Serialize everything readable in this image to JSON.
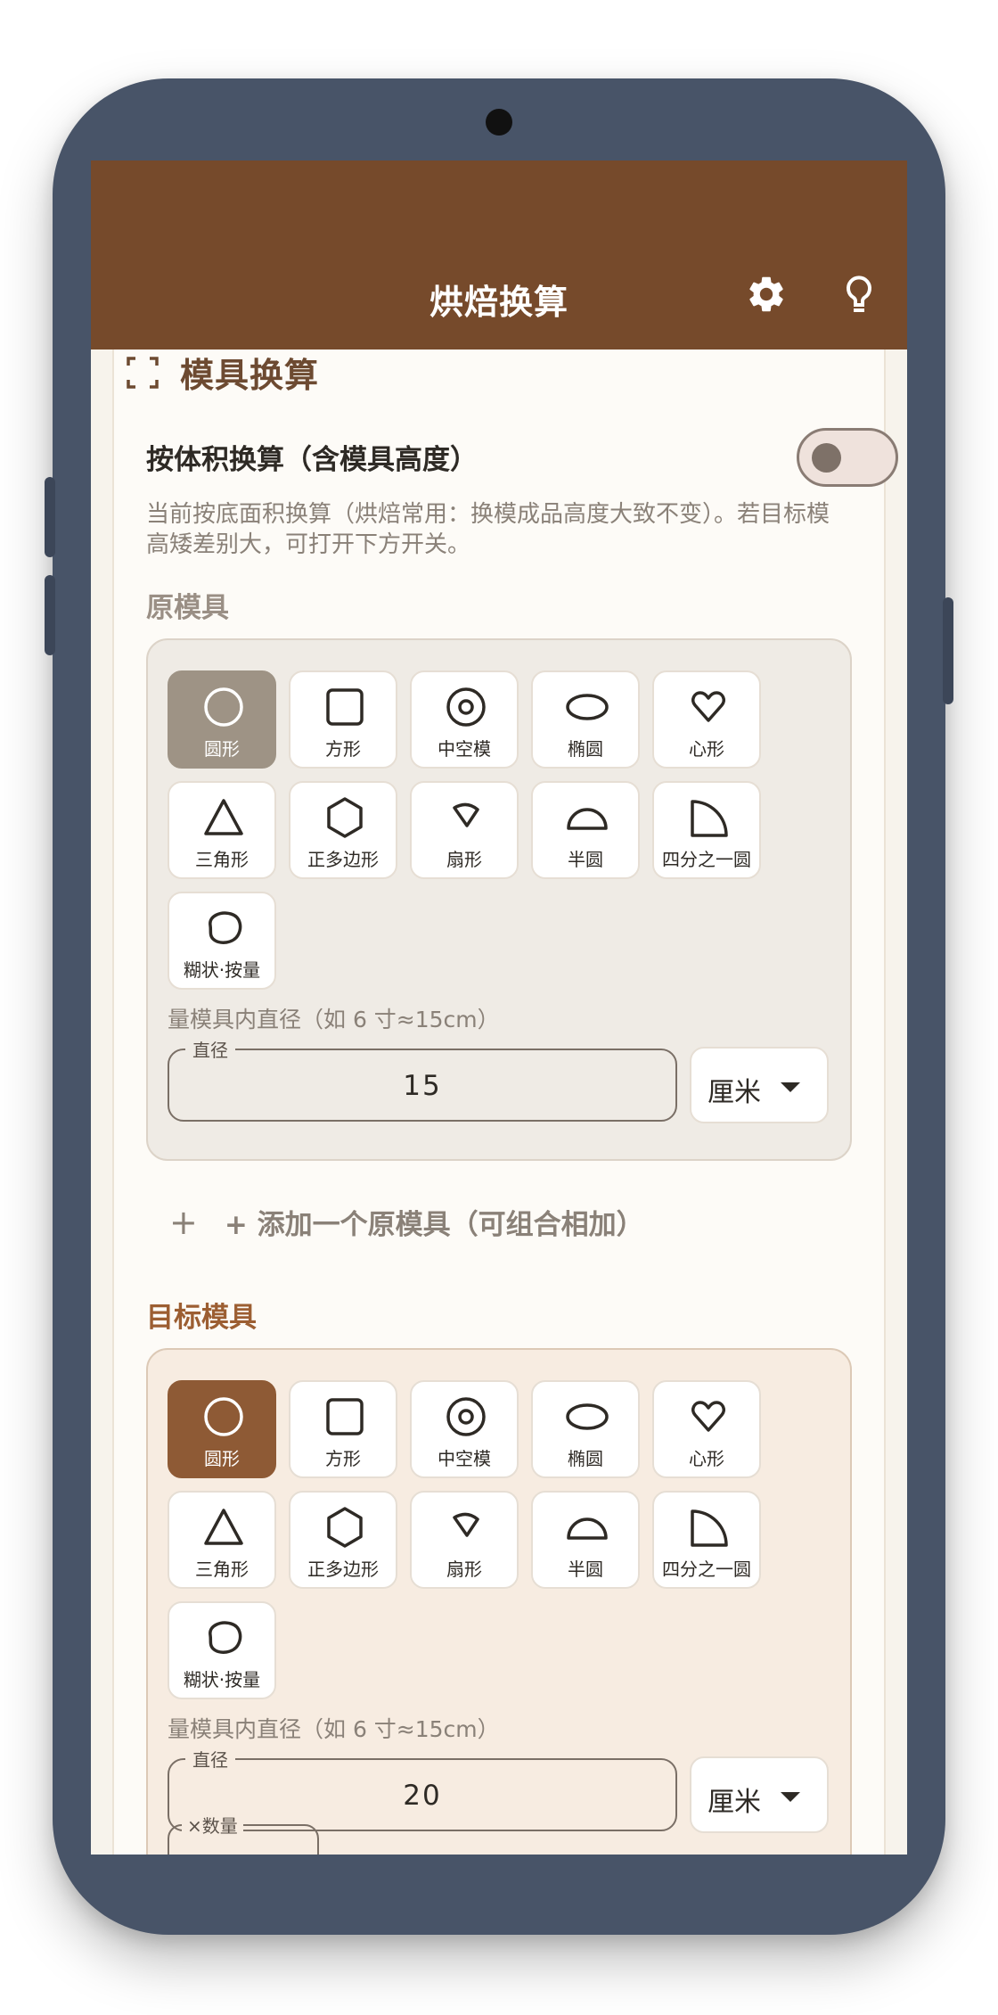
{
  "appbar": {
    "title": "烘焙换算",
    "settings_icon": "gear-icon",
    "tips_icon": "lightbulb-icon"
  },
  "section": {
    "title": "模具换算",
    "icon": "crop-frame-icon"
  },
  "volume_toggle": {
    "label": "按体积换算（含模具高度）",
    "on": false
  },
  "hint": "当前按底面积换算（烘焙常用：换模成品高度大致不变）。若目标模高矮差别大，可打开下方开关。",
  "source": {
    "label": "原模具",
    "shapes": [
      "圆形",
      "方形",
      "中空模",
      "椭圆",
      "心形",
      "三角形",
      "正多边形",
      "扇形",
      "半圆",
      "四分之一圆",
      "糊状·按量"
    ],
    "selected": "圆形",
    "measure_hint": "量模具内直径（如 6 寸≈15cm）",
    "field_label": "直径",
    "value": "15",
    "unit": "厘米"
  },
  "add_source": {
    "plus": "+",
    "label": "+ 添加一个原模具（可组合相加）"
  },
  "target": {
    "label": "目标模具",
    "shapes": [
      "圆形",
      "方形",
      "中空模",
      "椭圆",
      "心形",
      "三角形",
      "正多边形",
      "扇形",
      "半圆",
      "四分之一圆",
      "糊状·按量"
    ],
    "selected": "圆形",
    "measure_hint": "量模具内直径（如 6 寸≈15cm）",
    "field_label": "直径",
    "value": "20",
    "unit": "厘米",
    "quantity_label": "×数量"
  },
  "colors": {
    "appbar": "#764a2b",
    "source_selected": "#9e9385",
    "target_selected": "#8e5a35",
    "source_label": "#9a8f85",
    "target_label": "#9c5e32"
  }
}
